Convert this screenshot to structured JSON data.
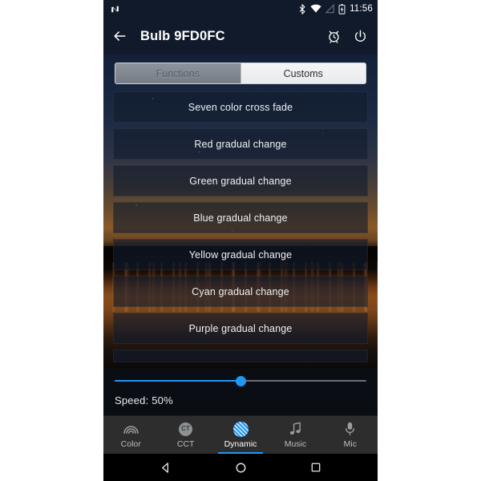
{
  "statusbar": {
    "logo_icon": "android-n-logo",
    "icons": [
      "bluetooth-icon",
      "wifi-off-icon",
      "cell-signal-off-icon",
      "battery-charging-icon"
    ],
    "time": "11:56"
  },
  "appbar": {
    "back_icon": "arrow-left-icon",
    "title": "Bulb 9FD0FC",
    "timer_icon": "alarm-clock-icon",
    "power_icon": "power-icon"
  },
  "tabs": [
    {
      "label": "Functions",
      "selected": true
    },
    {
      "label": "Customs",
      "selected": false
    }
  ],
  "presets": [
    {
      "label": "Seven color cross fade"
    },
    {
      "label": "Red gradual change"
    },
    {
      "label": "Green gradual change"
    },
    {
      "label": "Blue gradual change"
    },
    {
      "label": "Yellow gradual change"
    },
    {
      "label": "Cyan gradual change"
    },
    {
      "label": "Purple gradual change"
    }
  ],
  "slider": {
    "value": 50,
    "label": "Speed: 50%",
    "fill_color": "#2196f3",
    "track_color": "#6b6f75"
  },
  "bottomnav": [
    {
      "label": "Color",
      "icon": "rainbow-icon",
      "active": false
    },
    {
      "label": "CCT",
      "icon": "cct-circle-icon",
      "active": false,
      "glyph": "CT"
    },
    {
      "label": "Dynamic",
      "icon": "striped-circle-icon",
      "active": true
    },
    {
      "label": "Music",
      "icon": "music-note-icon",
      "active": false
    },
    {
      "label": "Mic",
      "icon": "microphone-icon",
      "active": false
    }
  ],
  "sysnav": [
    {
      "name": "back-triangle-icon"
    },
    {
      "name": "home-circle-icon"
    },
    {
      "name": "recents-square-icon"
    }
  ],
  "theme": {
    "accent": "#2196f3",
    "appbar_bg": "#111a2b",
    "nav_bg": "#2d2d2d"
  }
}
